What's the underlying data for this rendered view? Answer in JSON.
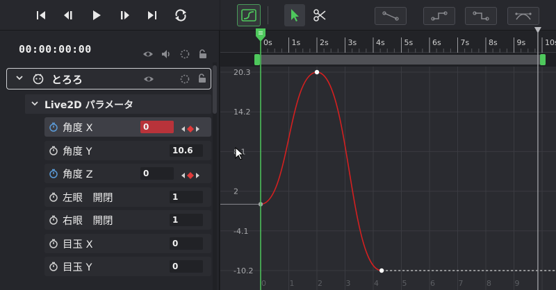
{
  "timeline": {
    "timecode": "00:00:00:00",
    "model_name": "とろろ",
    "group_name": "Live2D パラメータ",
    "params": [
      {
        "label": "角度 X",
        "value": "0",
        "highlight": true,
        "selected": true,
        "keyframes": true
      },
      {
        "label": "角度 Y",
        "value": "10.6",
        "highlight": false,
        "selected": false,
        "keyframes": false
      },
      {
        "label": "角度 Z",
        "value": "0",
        "highlight": false,
        "selected": false,
        "keyframes": true
      },
      {
        "label": "左眼　開閉",
        "value": "1",
        "highlight": false,
        "selected": false,
        "keyframes": false
      },
      {
        "label": "右眼　開閉",
        "value": "1",
        "highlight": false,
        "selected": false,
        "keyframes": false
      },
      {
        "label": "目玉 X",
        "value": "0",
        "highlight": false,
        "selected": false,
        "keyframes": false
      },
      {
        "label": "目玉 Y",
        "value": "0",
        "highlight": false,
        "selected": false,
        "keyframes": false
      }
    ]
  },
  "ruler": {
    "ticks": [
      "0s",
      "1s",
      "2s",
      "3s",
      "4s",
      "5s",
      "6s",
      "7s",
      "8s",
      "9s",
      "10s"
    ]
  },
  "graph": {
    "y_labels": [
      "20.3",
      "14.2",
      "8.1",
      "2",
      "-4.1",
      "-10.2"
    ],
    "x_labels": [
      "0",
      "1",
      "2",
      "3",
      "4",
      "5",
      "6",
      "7",
      "8",
      "9"
    ],
    "keyframes": [
      {
        "t": 0,
        "v": 0
      },
      {
        "t": 2,
        "v": 20.3
      },
      {
        "t": 4.3,
        "v": -10.2
      }
    ],
    "curve_color": "#d42020",
    "playhead_color": "#4ec85c"
  },
  "colors": {
    "accent_green": "#4ec85c",
    "value_red": "#b8333a",
    "panel_bg": "#25262b"
  }
}
